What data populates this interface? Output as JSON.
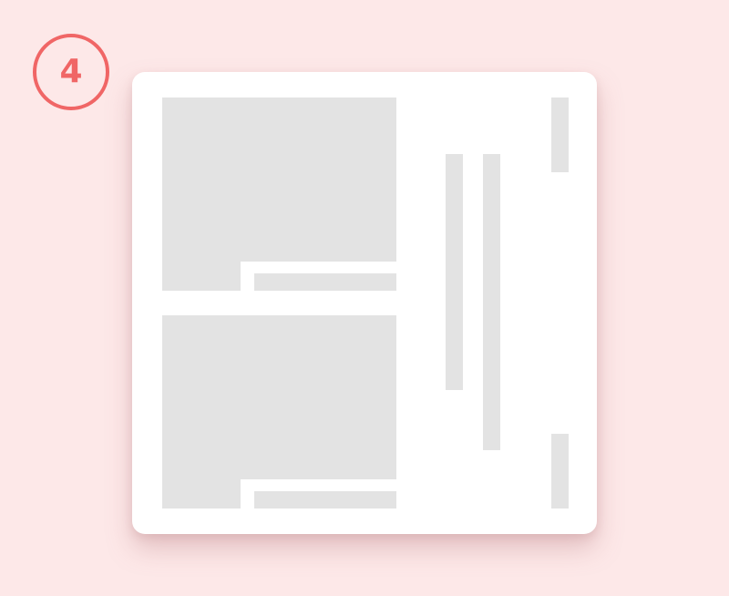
{
  "badge": {
    "step_number": "4",
    "color": "#F06666"
  },
  "colors": {
    "background": "#FDE8E8",
    "card": "#FFFFFF",
    "placeholder": "#E3E3E3"
  }
}
